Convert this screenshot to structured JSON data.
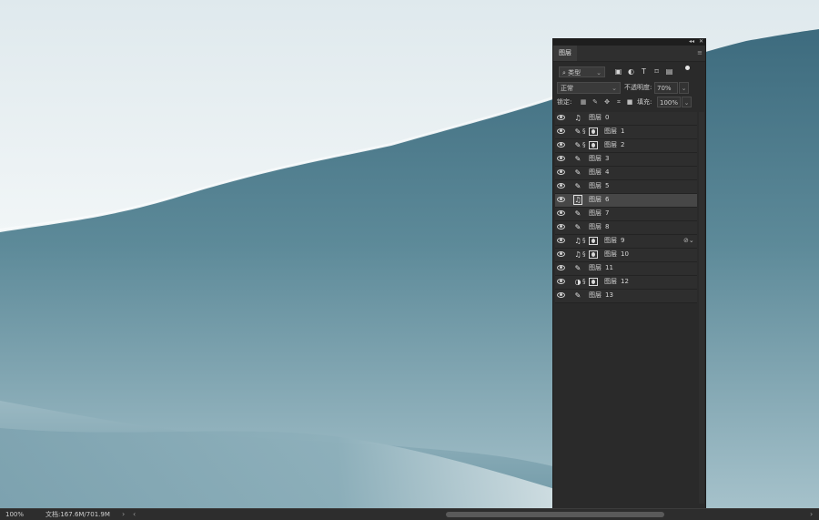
{
  "layers_panel": {
    "tab_label": "图层",
    "title_controls": [
      "◂◂",
      "✕"
    ],
    "menu_icon": "panel-menu-icon",
    "filter_kind": "类型",
    "filter_icons": [
      "image-filter-icon",
      "adjustment-filter-icon",
      "type-filter-icon",
      "shape-filter-icon",
      "smart-object-filter-icon"
    ],
    "blend_mode": "正常",
    "opacity_label": "不透明度:",
    "opacity_value": "70%",
    "lock_label": "锁定:",
    "lock_icons": [
      "lock-transparent-icon",
      "lock-paint-icon",
      "lock-move-icon",
      "lock-artboard-icon",
      "lock-all-icon"
    ],
    "fill_label": "填充:",
    "fill_value": "100%",
    "layers": [
      {
        "name": "图层",
        "num": "0",
        "icon": "smart-filter-icon",
        "chain": false,
        "mask": false,
        "selected": false
      },
      {
        "name": "图层",
        "num": "1",
        "icon": "brush-icon",
        "chain": true,
        "mask": true,
        "selected": false
      },
      {
        "name": "图层",
        "num": "2",
        "icon": "brush-icon",
        "chain": true,
        "mask": true,
        "selected": false
      },
      {
        "name": "图层",
        "num": "3",
        "icon": "brush-icon",
        "chain": false,
        "mask": false,
        "selected": false
      },
      {
        "name": "图层",
        "num": "4",
        "icon": "brush-icon",
        "chain": false,
        "mask": false,
        "selected": false
      },
      {
        "name": "图层",
        "num": "5",
        "icon": "brush-icon",
        "chain": false,
        "mask": false,
        "selected": false
      },
      {
        "name": "图层",
        "num": "6",
        "icon": "smart-filter-icon",
        "chain": false,
        "mask": false,
        "selected": true
      },
      {
        "name": "图层",
        "num": "7",
        "icon": "brush-icon",
        "chain": false,
        "mask": false,
        "selected": false
      },
      {
        "name": "图层",
        "num": "8",
        "icon": "brush-icon",
        "chain": false,
        "mask": false,
        "selected": false
      },
      {
        "name": "图层",
        "num": "9",
        "icon": "smart-filter-icon",
        "chain": true,
        "mask": true,
        "selected": false,
        "smart_badge": true
      },
      {
        "name": "图层",
        "num": "10",
        "icon": "smart-filter-icon",
        "chain": true,
        "mask": true,
        "selected": false
      },
      {
        "name": "图层",
        "num": "11",
        "icon": "brush-icon",
        "chain": false,
        "mask": false,
        "selected": false
      },
      {
        "name": "图层",
        "num": "12",
        "icon": "adjustment-icon",
        "chain": true,
        "mask": true,
        "selected": false
      },
      {
        "name": "图层",
        "num": "13",
        "icon": "brush-icon",
        "chain": false,
        "mask": false,
        "selected": false
      }
    ]
  },
  "status_bar": {
    "zoom": "100%",
    "doc_info": "文档:167.6M/701.9M",
    "arrow_right": "›",
    "arrow_left": "‹",
    "arrow_end": "›"
  },
  "colors": {
    "sky": "#eef3f5",
    "sea_dark": "#416f82",
    "sea_light": "#8fb4c0",
    "panel_bg": "#2a2a2a",
    "selected_row": "#474747"
  }
}
